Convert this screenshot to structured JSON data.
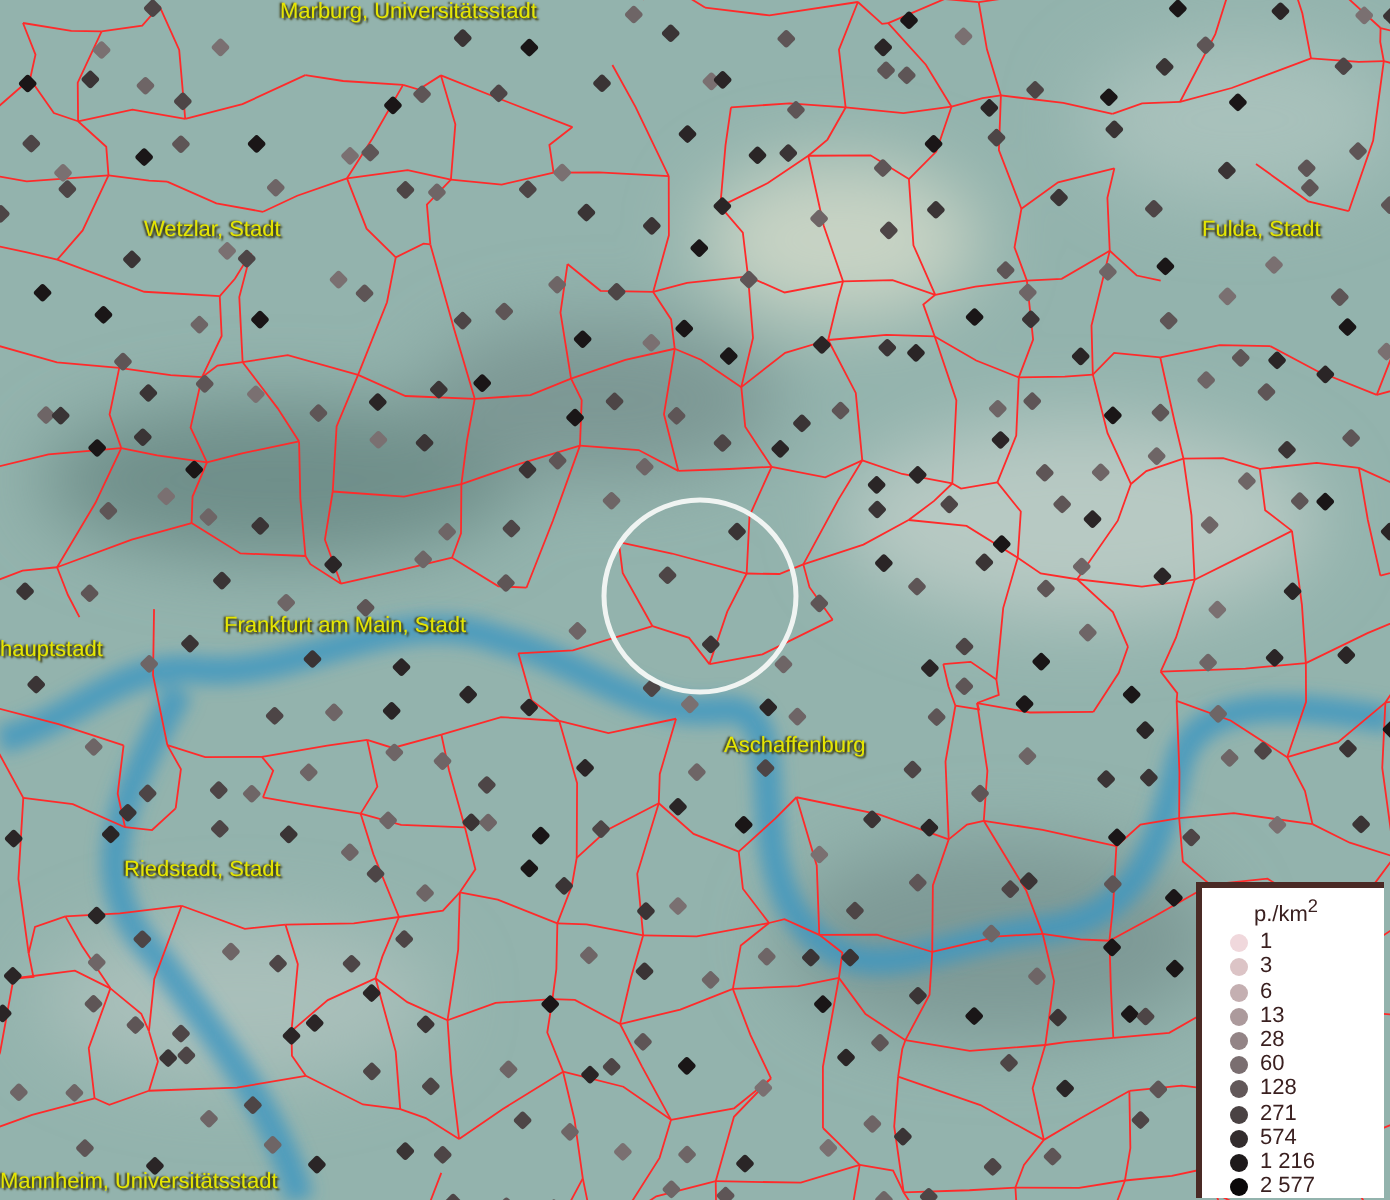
{
  "map": {
    "place_labels": [
      "Marburg, Universitätsstadt",
      "Wetzlar, Stadt",
      "Fulda, Stadt",
      "hauptstadt",
      "Frankfurt am Main, Stadt",
      "Aschaffenburg",
      "Riedstadt, Stadt",
      "Mannheim, Universitätsstadt"
    ]
  },
  "legend": {
    "title": "p./km$^{2}$",
    "items": [
      {
        "label": "1",
        "color": "#f0d8dc"
      },
      {
        "label": "3",
        "color": "#dcc4c6"
      },
      {
        "label": "6",
        "color": "#c4afb1"
      },
      {
        "label": "13",
        "color": "#ac9a9c"
      },
      {
        "label": "28",
        "color": "#938486"
      },
      {
        "label": "60",
        "color": "#7a6e70"
      },
      {
        "label": "128",
        "color": "#625859"
      },
      {
        "label": "271",
        "color": "#4a4243"
      },
      {
        "label": "574",
        "color": "#332d2e"
      },
      {
        "label": "1 216",
        "color": "#1e1a1b"
      },
      {
        "label": "2 577",
        "color": "#0a0809"
      }
    ]
  }
}
